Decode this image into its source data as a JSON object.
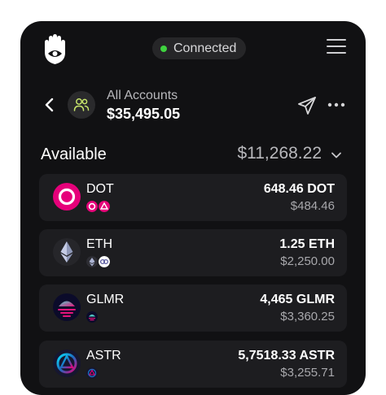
{
  "header": {
    "status_label": "Connected",
    "status_color": "#3fd33f"
  },
  "account": {
    "name": "All Accounts",
    "total": "$35,495.05"
  },
  "available": {
    "label": "Available",
    "amount": "$11,268.22"
  },
  "tokens": [
    {
      "symbol": "DOT",
      "amount": "648.46 DOT",
      "usd": "$484.46",
      "icon": "polkadot-icon",
      "chains": [
        "polkadot-chain-icon",
        "astar-chain-icon"
      ]
    },
    {
      "symbol": "ETH",
      "amount": "1.25 ETH",
      "usd": "$2,250.00",
      "icon": "ethereum-icon",
      "chains": [
        "ethereum-chain-icon",
        "moonbeam-chain-icon"
      ]
    },
    {
      "symbol": "GLMR",
      "amount": "4,465 GLMR",
      "usd": "$3,360.25",
      "icon": "moonbeam-icon",
      "chains": [
        "moonbeam-chain-icon"
      ]
    },
    {
      "symbol": "ASTR",
      "amount": "5,7518.33 ASTR",
      "usd": "$3,255.71",
      "icon": "astar-icon",
      "chains": [
        "astar-chain-icon"
      ]
    }
  ],
  "colors": {
    "panel": "#111113",
    "card": "#1d1d20",
    "polkadot": "#e6007a",
    "astar": "#1b6dc1",
    "accent_green": "#c8e66b"
  }
}
